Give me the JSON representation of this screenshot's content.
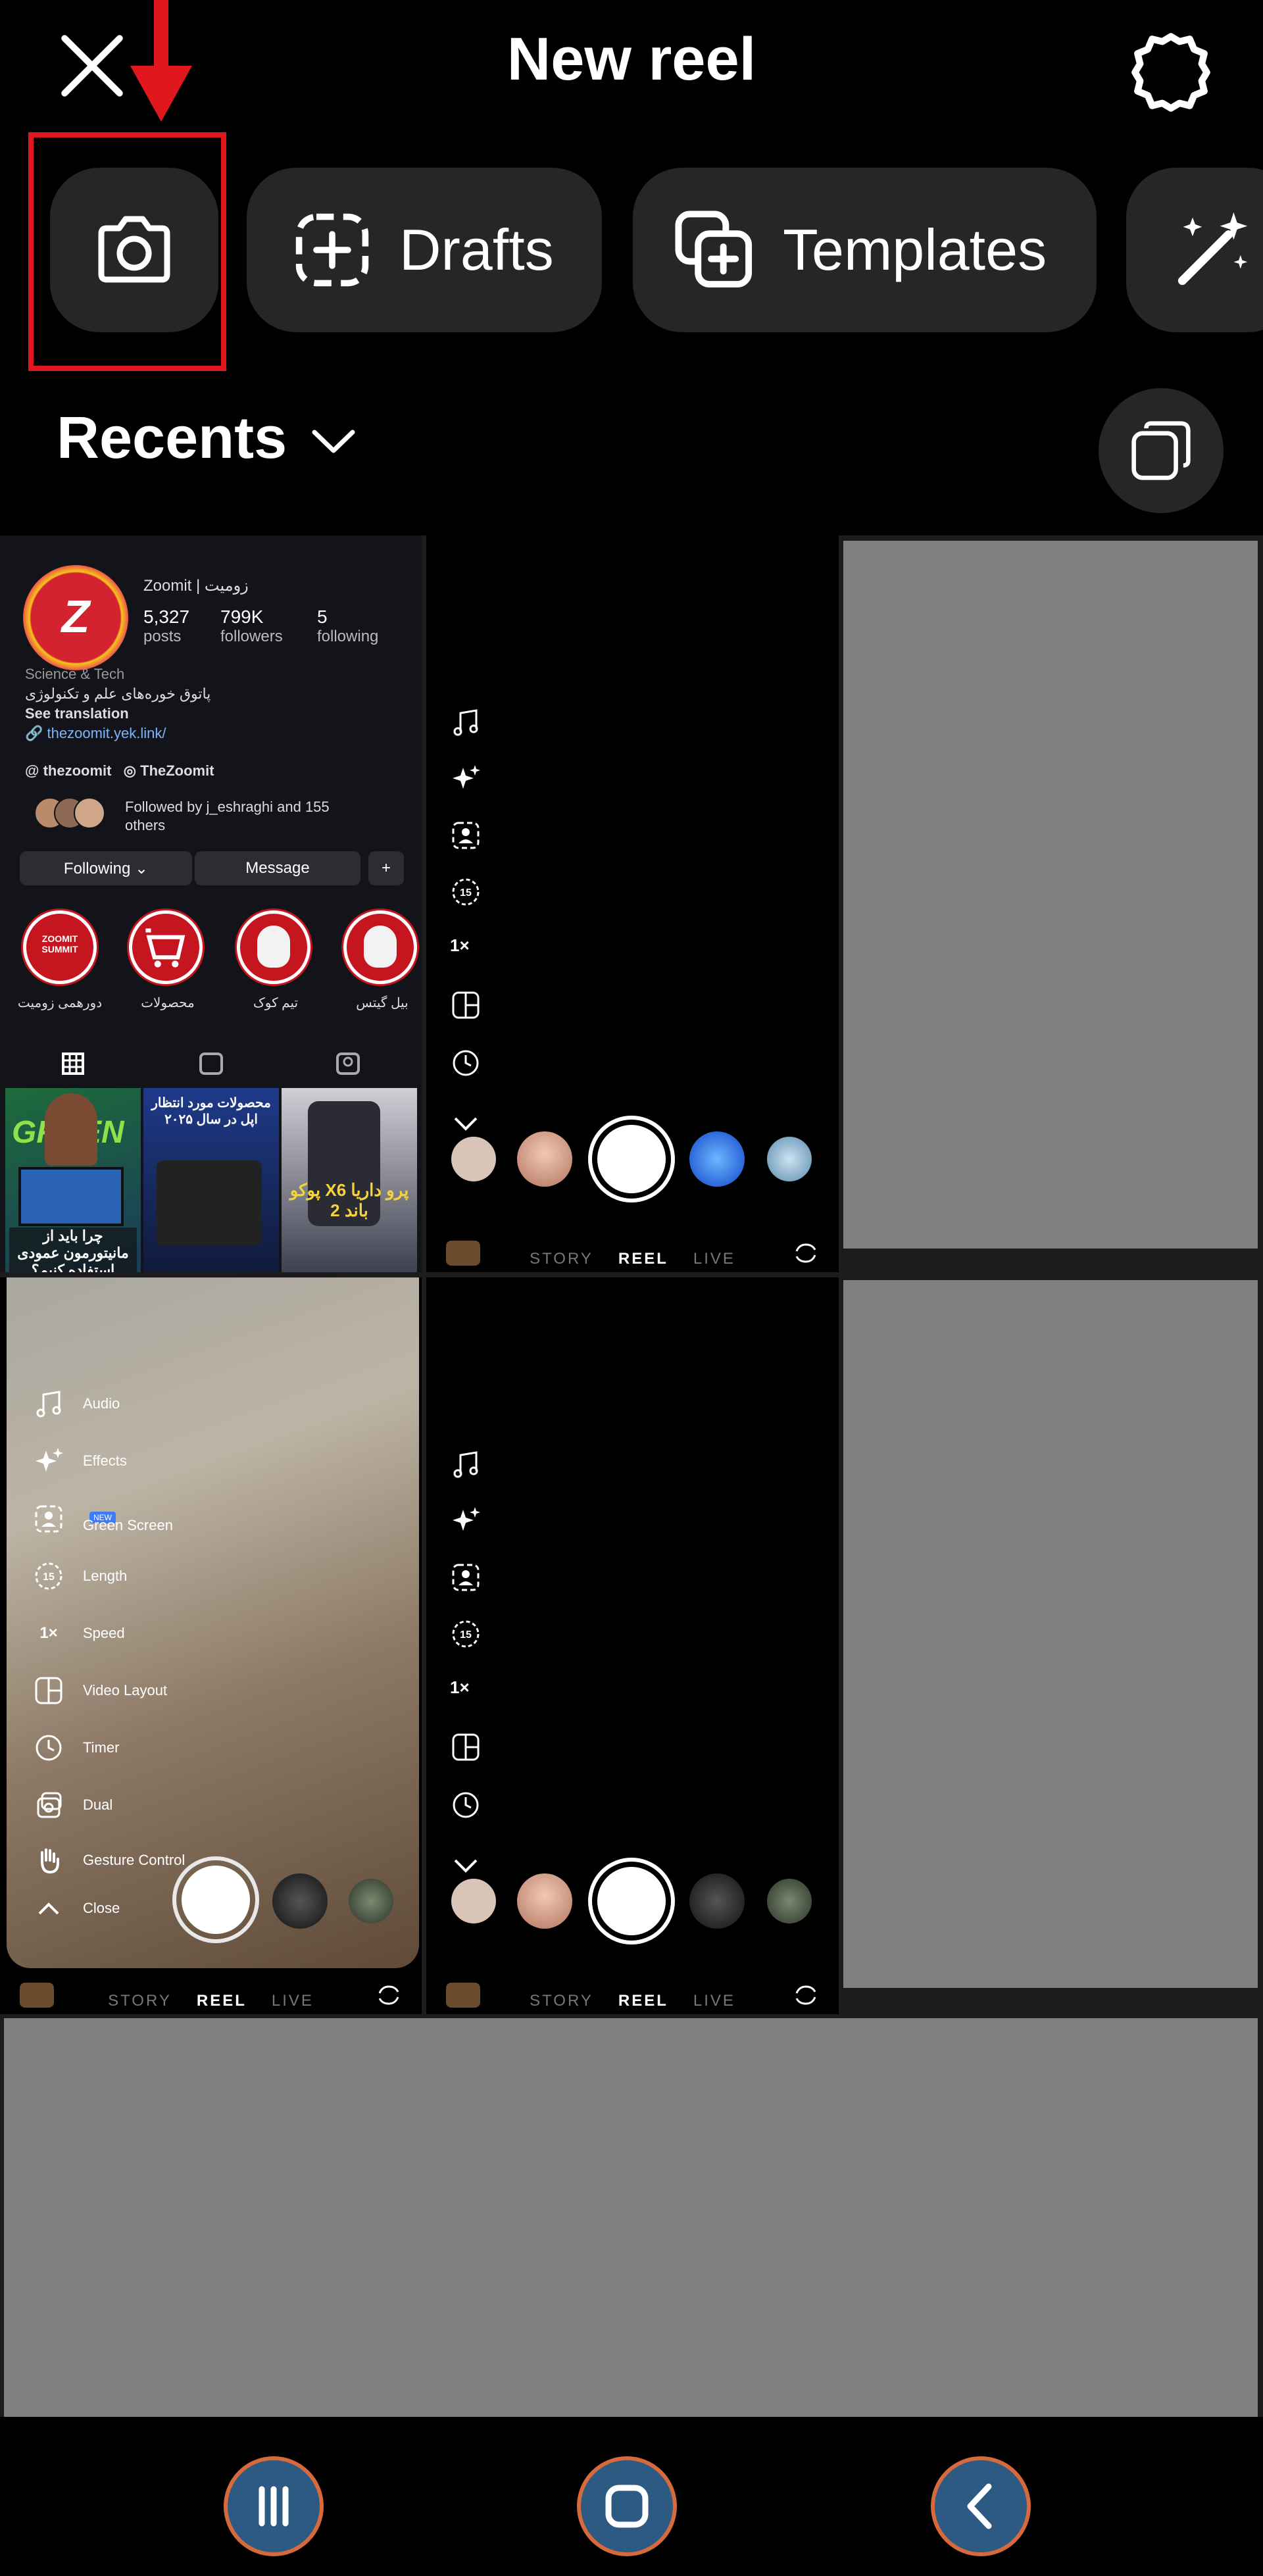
{
  "header": {
    "title": "New reel",
    "close_icon": "close-icon",
    "settings_icon": "gear-icon"
  },
  "chips": {
    "camera_icon": "camera-icon",
    "drafts_label": "Drafts",
    "templates_label": "Templates",
    "magic_icon": "magic-wand-icon"
  },
  "annotation": {
    "arrow_color": "#e0181e",
    "box_color": "#e0181e"
  },
  "recents": {
    "label": "Recents",
    "multi_select_icon": "multi-select-icon"
  },
  "profile": {
    "name": "Zoomit | زومیت",
    "posts_value": "5,327",
    "posts_label": "posts",
    "followers_value": "799K",
    "followers_label": "followers",
    "following_value": "5",
    "following_label": "following",
    "category": "Science & Tech",
    "bio": "پاتوق خوره‌های علم و تکنولوژی",
    "see_translation": "See translation",
    "link": "thezoomit.yek.link/",
    "handle_threads": "thezoomit",
    "handle_other": "TheZoomit",
    "followed_by": "Followed by j_eshraghi and 155",
    "followed_by_2": "others",
    "btn_following": "Following ⌄",
    "btn_message": "Message",
    "highlights": [
      "دورهمی زومیت",
      "محصولات",
      "تیم کوک",
      "بیل گیتس"
    ],
    "highlight_1_inner": "ZOOMIT SUMMIT",
    "post_1_text": "GREEN",
    "post_1_caption": "چرا باید از مانیتورمون عمودی استفاده کنیم؟",
    "post_2_caption": "محصولات مورد انتظار اپل در سال ۲۰۲۵",
    "post_3_caption": "پوکو X6 پرو داریا باند 2"
  },
  "camera": {
    "modes": [
      "STORY",
      "REEL",
      "LIVE"
    ],
    "speed": "1×",
    "length": "15"
  },
  "menu": {
    "items": [
      "Audio",
      "Effects",
      "Green Screen",
      "Length",
      "Speed",
      "Video Layout",
      "Timer",
      "Dual",
      "Gesture Control",
      "Close"
    ],
    "new_badge": "NEW",
    "length_icon_text": "15",
    "speed_icon_text": "1×"
  },
  "navbar": {
    "recent_icon": "recent-apps-icon",
    "home_icon": "home-icon",
    "back_icon": "back-icon"
  }
}
